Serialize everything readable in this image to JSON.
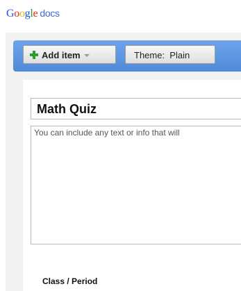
{
  "header": {
    "logo_letters": [
      "G",
      "o",
      "o",
      "g",
      "l",
      "e"
    ],
    "logo_product": "docs"
  },
  "toolbar": {
    "add_item_label": "Add item",
    "theme_label": "Theme:  Plain"
  },
  "form": {
    "title": "Math Quiz",
    "description_text": "You can include any text or info that will",
    "first_field_label": "Class / Period"
  },
  "colors": {
    "toolbar_blue": "#5b93df",
    "add_icon_green": "#2f9b2f",
    "editor_background": "#f2f2f2"
  }
}
